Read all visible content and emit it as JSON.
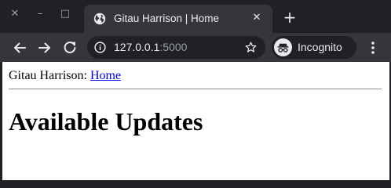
{
  "window": {
    "close_glyph": "✕",
    "minimize_glyph": "–",
    "maximize_glyph": "□"
  },
  "tab": {
    "title": "Gitau Harrison | Home",
    "close_glyph": "✕",
    "favicon": "globe-icon"
  },
  "new_tab_glyph": "+",
  "toolbar": {
    "back_icon": "arrow-left-icon",
    "forward_icon": "arrow-right-icon",
    "reload_icon": "reload-icon",
    "url_host": "127.0.0.1",
    "url_port": ":5000",
    "bookmark_icon": "star-icon",
    "profile_label": "Incognito",
    "menu_icon": "kebab-menu-icon"
  },
  "page": {
    "nav_prefix": "Gitau Harrison:",
    "nav_link": "Home",
    "heading": "Available Updates"
  },
  "colors": {
    "frame": "#202124",
    "toolbar": "#35363a",
    "text_light": "#e8eaed",
    "text_dim": "#9aa0a6",
    "link": "#0000ee"
  }
}
